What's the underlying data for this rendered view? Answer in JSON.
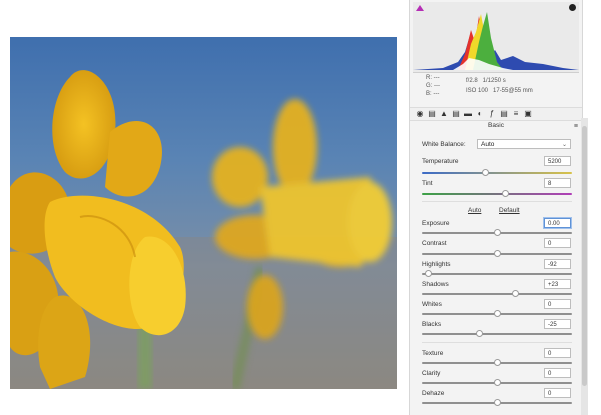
{
  "histogram": {
    "clip_shadow_icon": "triangle-magenta",
    "clip_highlight_icon": "triangle-black",
    "colors": {
      "red": "#e5322b",
      "green": "#4caf3e",
      "yellow": "#f0d82a",
      "blue": "#2e4bb0",
      "white": "#ffffff"
    }
  },
  "readout": {
    "r": "R:  ---",
    "g": "G:  ---",
    "b": "B:  ---",
    "exif_line1": "f/2.8   1/1250 s",
    "exif_line2": "ISO 100   17-55@55 mm"
  },
  "tools": [
    "basic-icon",
    "tone-curve-icon",
    "detail-icon",
    "hsl-icon",
    "split-toning-icon",
    "lens-icon",
    "fx-icon",
    "calibration-icon",
    "presets-icon",
    "snapshots-icon"
  ],
  "section": {
    "title": "Basic",
    "menu": "≡"
  },
  "white_balance": {
    "label": "White Balance:",
    "value": "Auto"
  },
  "controls": {
    "temperature": {
      "label": "Temperature",
      "value": "5200",
      "position": 0.42
    },
    "tint": {
      "label": "Tint",
      "value": "8",
      "position": 0.55
    },
    "auto": "Auto",
    "default": "Default",
    "exposure": {
      "label": "Exposure",
      "value": "0.00",
      "position": 0.5
    },
    "contrast": {
      "label": "Contrast",
      "value": "0",
      "position": 0.5
    },
    "highlights": {
      "label": "Highlights",
      "value": "-92",
      "position": 0.04
    },
    "shadows": {
      "label": "Shadows",
      "value": "+23",
      "position": 0.62
    },
    "whites": {
      "label": "Whites",
      "value": "0",
      "position": 0.5
    },
    "blacks": {
      "label": "Blacks",
      "value": "-25",
      "position": 0.38
    },
    "texture": {
      "label": "Texture",
      "value": "0",
      "position": 0.5
    },
    "clarity": {
      "label": "Clarity",
      "value": "0",
      "position": 0.5
    },
    "dehaze": {
      "label": "Dehaze",
      "value": "0",
      "position": 0.5
    }
  }
}
